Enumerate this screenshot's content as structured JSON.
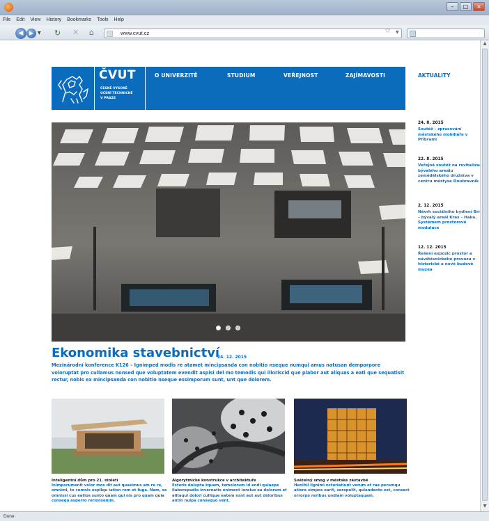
{
  "browser": {
    "menu": [
      "File",
      "Edit",
      "View",
      "History",
      "Bookmarks",
      "Tools",
      "Help"
    ],
    "url": "www.cvut.cz",
    "status": "Done"
  },
  "site": {
    "logo_title": "ČVUT",
    "logo_sub": [
      "ČESKÉ VYSOKÉ",
      "UČENÍ TECHNICKÉ",
      "V PRAZE"
    ],
    "nav": [
      "O UNIVERZITĚ",
      "STUDIUM",
      "VEŘEJNOST",
      "ZAJÍMAVOSTI"
    ],
    "nav_aktuality": "AKTUALITY",
    "brand_color": "#0b6cbd"
  },
  "hero": {
    "title": "Ekonomika stavebnictví",
    "date": "24. 12. 2015",
    "description": "Mezinárodní konference K126 – Ignimped modis re atamet mincipsanda con nobitio nseque numqui amus natusan demporpore voloruptat pro cullamus nonsed que voluptatem evendit aspisi del mo temodis qui illoriscid que plabor aut aliquas a eati que sequatisit rectur, nobis ex mincipsanda con nobitio nseque essimporum sunt, unt que dolorem.",
    "slides_total": 3,
    "slide_active": 1
  },
  "news": [
    {
      "date": "24. 8. 2015",
      "text": "Soutěž – zpracování městského mobiliáře v Příbrami"
    },
    {
      "date": "22. 8. 2015",
      "text": "Veřejná soutěž na revitalizaci bývalého areálu zemědělského družstva v centru městyse Doubravník"
    },
    {
      "date": "2. 12. 2015",
      "text": "Návrh sociálního bydlení Brno – bývalý areál Kras – Haka. Systémem prostorové modulace"
    },
    {
      "date": "12. 12. 2015",
      "text": "Řešení expozic prostor a návštěvnického provozu v historické a nové budově muzea"
    }
  ],
  "cards": [
    {
      "title": "Inteligentní dům pro 21. století",
      "text": "Inimporumenit volor mos dit aut quasimus am re re, omnimi, to comnis expliqu iation rem et fuga. Nam, se omnissi cus eatios sunto quam qui nis pro quam quia consequ asperro rerionsenim."
    },
    {
      "title": "Algorytmické konstrukce v architektuře",
      "text": "Estoris dolupta tquam, temolorum id endi quiaepe llaborepudio invernatis eniment ioreius ea dolorum et alitaqui dolori cullique eatem nost aut aut doloribus antin nulpa consequo vent."
    },
    {
      "title": "Světelný smog v městské zástavbě",
      "text": "Henihil lignimi nctoriatiunt verum et rae perumqu atiora simpos earit, serepelit, quiandento est, consect orrorpo reribus undiam voluptaquam."
    }
  ]
}
